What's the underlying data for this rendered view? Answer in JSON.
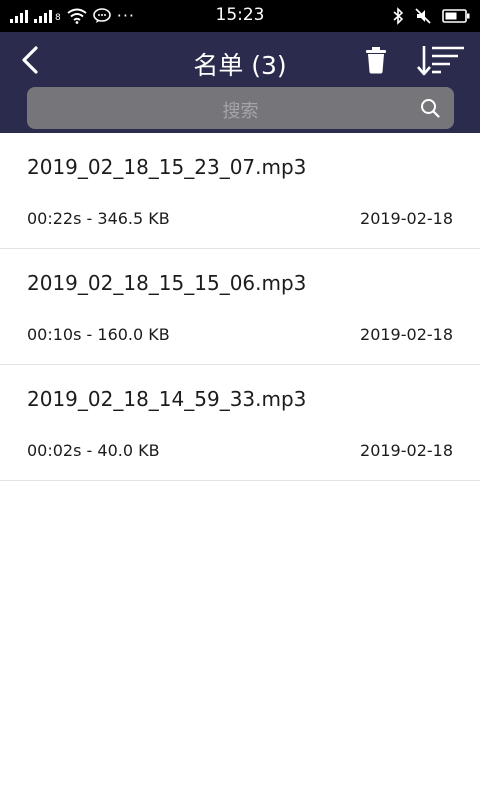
{
  "status_bar": {
    "time": "15:23",
    "signal_1_label": "",
    "signal_2_label": "8",
    "overflow_dots": "···"
  },
  "header": {
    "title": "名单 (3)",
    "back_icon": "chevron-left",
    "delete_icon": "trash",
    "sort_icon": "sort-lines"
  },
  "search": {
    "placeholder": "搜索",
    "icon": "search"
  },
  "recordings": [
    {
      "name": "2019_02_18_15_23_07.mp3",
      "info": "00:22s - 346.5 KB",
      "date": "2019-02-18"
    },
    {
      "name": "2019_02_18_15_15_06.mp3",
      "info": "00:10s - 160.0 KB",
      "date": "2019-02-18"
    },
    {
      "name": "2019_02_18_14_59_33.mp3",
      "info": "00:02s - 40.0 KB",
      "date": "2019-02-18"
    }
  ],
  "colors": {
    "header_bg": "#2a2b4d",
    "search_bg": "#76767a",
    "divider": "#e3e3e3"
  }
}
